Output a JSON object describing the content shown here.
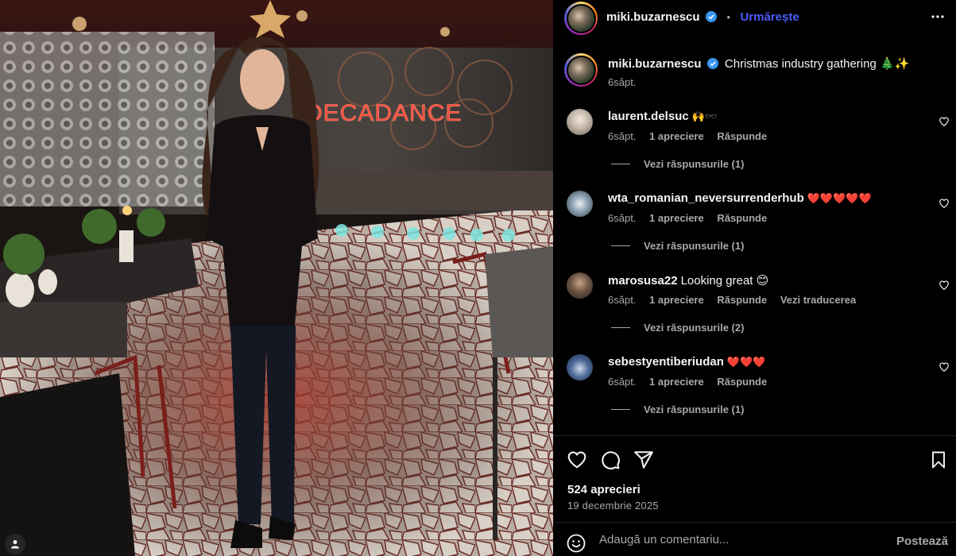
{
  "post": {
    "author": "miki.buzarnescu",
    "follow_label": "Urmărește",
    "caption": "Christmas industry gathering 🎄✨",
    "caption_time": "6săpt.",
    "neon_sign": "DECADANCE",
    "likes": "524 aprecieri",
    "date": "19 decembrie 2025"
  },
  "comments": [
    {
      "user": "laurent.delsuc",
      "text": "🙌🕶️",
      "time": "6săpt.",
      "likes": "1 apreciere",
      "reply": "Răspunde",
      "translate": "",
      "view_replies": "Vezi răspunsurile (1)"
    },
    {
      "user": "wta_romanian_neversurrenderhub",
      "text": "❤️❤️❤️❤️❤️",
      "time": "6săpt.",
      "likes": "1 apreciere",
      "reply": "Răspunde",
      "translate": "",
      "view_replies": "Vezi răspunsurile (1)"
    },
    {
      "user": "marosusa22",
      "text": "Looking great 😊",
      "time": "6săpt.",
      "likes": "1 apreciere",
      "reply": "Răspunde",
      "translate": "Vezi traducerea",
      "view_replies": "Vezi răspunsurile (2)"
    },
    {
      "user": "sebestyentiberiudan",
      "text": "❤️❤️❤️",
      "time": "6săpt.",
      "likes": "1 apreciere",
      "reply": "Răspunde",
      "translate": "",
      "view_replies": "Vezi răspunsurile (1)"
    }
  ],
  "composer": {
    "placeholder": "Adaugă un comentariu...",
    "post_label": "Postează"
  },
  "icons": {
    "verified": "verified-badge-icon",
    "more": "more-options-icon",
    "like": "heart-icon",
    "comment": "comment-icon",
    "share": "share-icon",
    "save": "bookmark-icon",
    "emoji": "emoji-icon",
    "tag": "user-tag-icon"
  },
  "colors": {
    "accent": "#4a5df9",
    "verified": "#3897f0",
    "muted": "#a8a8a8",
    "neon": "#ff3b30"
  }
}
